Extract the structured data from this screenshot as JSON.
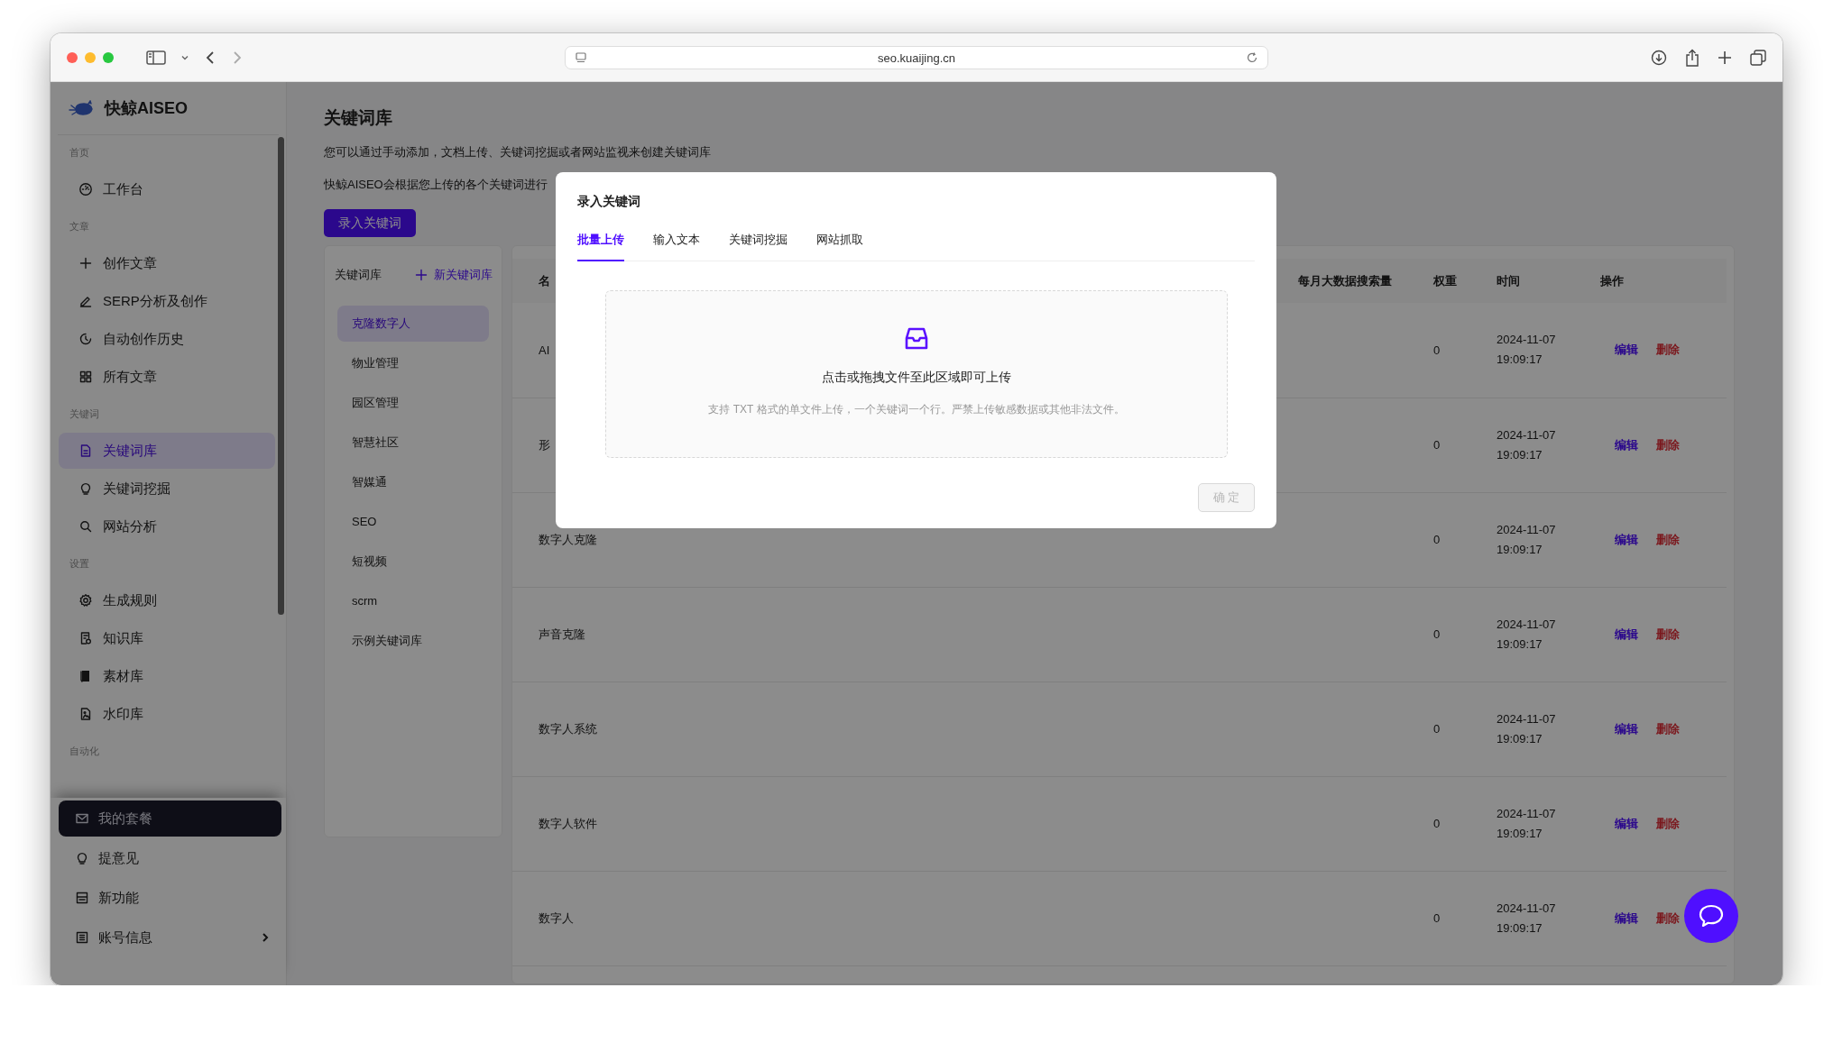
{
  "browser": {
    "url": "seo.kuaijing.cn"
  },
  "sidebar": {
    "logo": "快鲸AISEO",
    "sections": [
      {
        "title": "首页",
        "items": [
          {
            "label": "工作台",
            "selected": false
          }
        ]
      },
      {
        "title": "文章",
        "items": [
          {
            "label": "创作文章",
            "selected": false
          },
          {
            "label": "SERP分析及创作",
            "selected": false
          },
          {
            "label": "自动创作历史",
            "selected": false
          },
          {
            "label": "所有文章",
            "selected": false
          }
        ]
      },
      {
        "title": "关键词",
        "items": [
          {
            "label": "关键词库",
            "selected": true
          },
          {
            "label": "关键词挖掘",
            "selected": false
          },
          {
            "label": "网站分析",
            "selected": false
          }
        ]
      },
      {
        "title": "设置",
        "items": [
          {
            "label": "生成规则",
            "selected": false
          },
          {
            "label": "知识库",
            "selected": false
          },
          {
            "label": "素材库",
            "selected": false
          },
          {
            "label": "水印库",
            "selected": false
          }
        ]
      },
      {
        "title": "自动化"
      }
    ],
    "footer_items": [
      {
        "label": "我的套餐",
        "kind": "promo"
      },
      {
        "label": "提意见",
        "kind": "link"
      },
      {
        "label": "新功能",
        "kind": "link"
      },
      {
        "label": "账号信息",
        "kind": "submenu"
      }
    ]
  },
  "main": {
    "title": "关键词库",
    "descriptions": [
      "您可以通过手动添加，文档上传、关键词挖掘或者网站监视来创建关键词库",
      "快鲸AISEO会根据您上传的各个关键词进行"
    ],
    "add_button": "录入关键词",
    "library_panel": {
      "title": "关键词库",
      "new_button": "新关键词库",
      "items": [
        {
          "label": "克隆数字人",
          "selected": true
        },
        {
          "label": "物业管理",
          "selected": false
        },
        {
          "label": "园区管理",
          "selected": false
        },
        {
          "label": "智慧社区",
          "selected": false
        },
        {
          "label": "智媒通",
          "selected": false
        },
        {
          "label": "SEO",
          "selected": false
        },
        {
          "label": "短视频",
          "selected": false
        },
        {
          "label": "scrm",
          "selected": false
        },
        {
          "label": "示例关键词库",
          "selected": false
        }
      ]
    },
    "table": {
      "columns": [
        "名",
        "每月大数据搜索量",
        "权重",
        "时间",
        "操作"
      ],
      "rows": [
        {
          "name": "AI",
          "weight": "0",
          "time": "2024-11-07 19:09:17",
          "actions": [
            {
              "label": "编辑",
              "kind": "edit"
            },
            {
              "label": "删除",
              "kind": "delete"
            }
          ]
        },
        {
          "name": "形",
          "weight": "0",
          "time": "2024-11-07 19:09:17",
          "actions": [
            {
              "label": "编辑",
              "kind": "edit"
            },
            {
              "label": "删除",
              "kind": "delete"
            }
          ]
        },
        {
          "name": "数字人克隆",
          "weight": "0",
          "time": "2024-11-07 19:09:17",
          "actions": [
            {
              "label": "编辑",
              "kind": "edit"
            },
            {
              "label": "删除",
              "kind": "delete"
            }
          ]
        },
        {
          "name": "声音克隆",
          "weight": "0",
          "time": "2024-11-07 19:09:17",
          "actions": [
            {
              "label": "编辑",
              "kind": "edit"
            },
            {
              "label": "删除",
              "kind": "delete"
            }
          ]
        },
        {
          "name": "数字人系统",
          "weight": "0",
          "time": "2024-11-07 19:09:17",
          "actions": [
            {
              "label": "编辑",
              "kind": "edit"
            },
            {
              "label": "删除",
              "kind": "delete"
            }
          ]
        },
        {
          "name": "数字人软件",
          "weight": "0",
          "time": "2024-11-07 19:09:17",
          "actions": [
            {
              "label": "编辑",
              "kind": "edit"
            },
            {
              "label": "删除",
              "kind": "delete"
            }
          ]
        },
        {
          "name": "数字人",
          "weight": "0",
          "time": "2024-11-07 19:09:17",
          "actions": [
            {
              "label": "编辑",
              "kind": "edit"
            },
            {
              "label": "删除",
              "kind": "delete"
            }
          ]
        }
      ]
    }
  },
  "modal": {
    "title": "录入关键词",
    "tabs": [
      {
        "label": "批量上传",
        "selected": true
      },
      {
        "label": "输入文本",
        "selected": false
      },
      {
        "label": "关键词挖掘",
        "selected": false
      },
      {
        "label": "网站抓取",
        "selected": false
      }
    ],
    "upload": {
      "title": "点击或拖拽文件至此区域即可上传",
      "hint": "支持 TXT 格式的单文件上传，一个关键词一个行。严禁上传敏感数据或其他非法文件。"
    },
    "confirm_button": {
      "label": "确 定",
      "disabled": true
    }
  }
}
